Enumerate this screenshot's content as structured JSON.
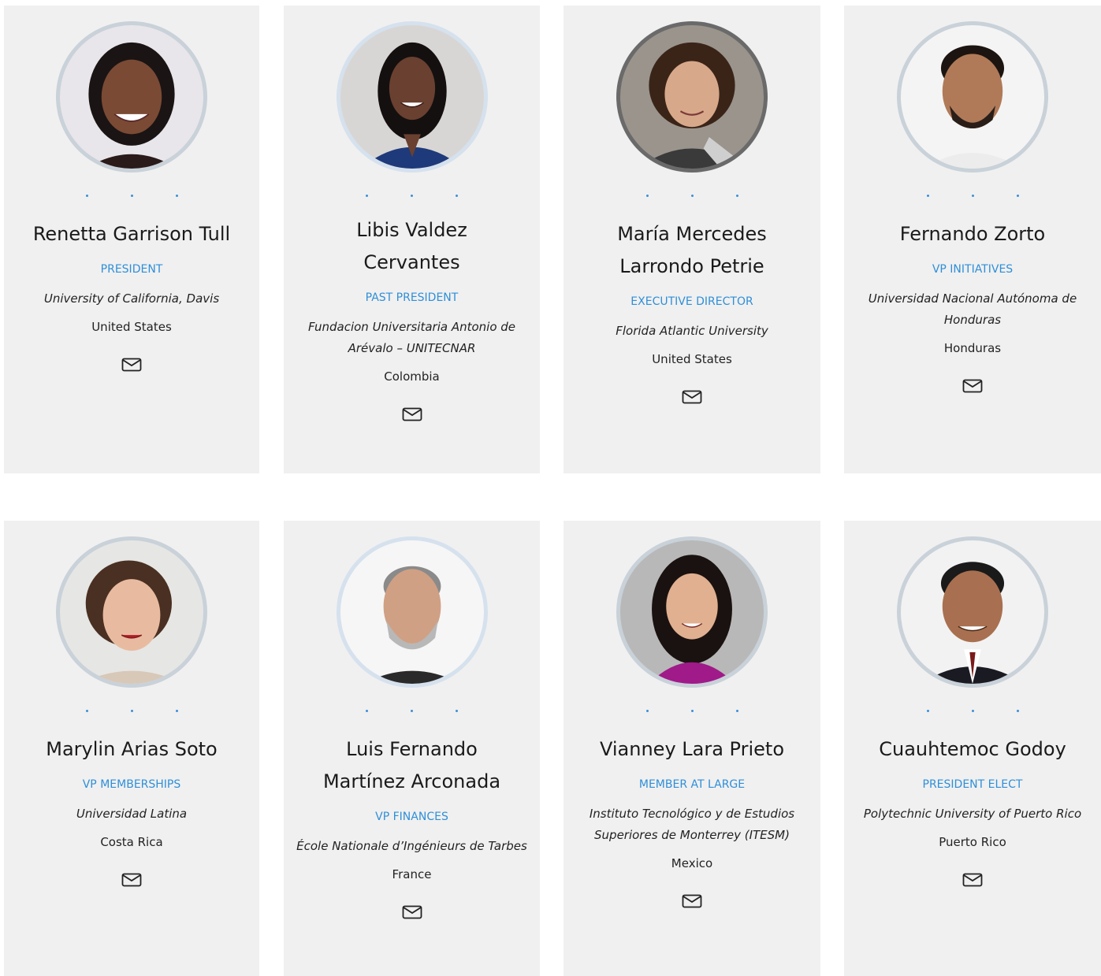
{
  "members": [
    {
      "name": "Renetta Garrison Tull",
      "role": "PRESIDENT",
      "institution": "University of California, Davis",
      "country": "United States",
      "photo": "woman-dark-hair-smiling"
    },
    {
      "name": "Libis Valdez Cervantes",
      "role": "PAST PRESIDENT",
      "institution": "Fundacion Universitaria Antonio de Arévalo – UNITECNAR",
      "country": "Colombia",
      "photo": "woman-long-dark-hair-blue-blazer"
    },
    {
      "name": "María Mercedes Larrondo Petrie",
      "role": "EXECUTIVE DIRECTOR",
      "institution": "Florida Atlantic University",
      "country": "United States",
      "photo": "woman-short-dark-hair"
    },
    {
      "name": "Fernando Zorto",
      "role": "VP INITIATIVES",
      "institution": "Universidad Nacional Autónoma de Honduras",
      "country": "Honduras",
      "photo": "man-beard-white-shirt"
    },
    {
      "name": "Marylin Arias Soto",
      "role": "VP MEMBERSHIPS",
      "institution": "Universidad Latina",
      "country": "Costa Rica",
      "photo": "woman-brown-hair-red-lips"
    },
    {
      "name": "Luis Fernando Martínez Arconada",
      "role": "VP FINANCES",
      "institution": "École Nationale d’Ingénieurs de Tarbes",
      "country": "France",
      "photo": "man-gray-beard"
    },
    {
      "name": "Vianney Lara Prieto",
      "role": "MEMBER AT LARGE",
      "institution": "Instituto Tecnológico y de Estudios Superiores de Monterrey (ITESM)",
      "country": "Mexico",
      "photo": "woman-magenta-scarf"
    },
    {
      "name": "Cuauhtemoc Godoy",
      "role": "PRESIDENT ELECT",
      "institution": "Polytechnic University of Puerto Rico",
      "country": "Puerto Rico",
      "photo": "man-suit-tie"
    }
  ],
  "colors": {
    "accent": "#2f8fd8",
    "card_bg": "#f0f0f0"
  },
  "icons": {
    "contact": "envelope-icon",
    "social": "social-dot-icon"
  }
}
